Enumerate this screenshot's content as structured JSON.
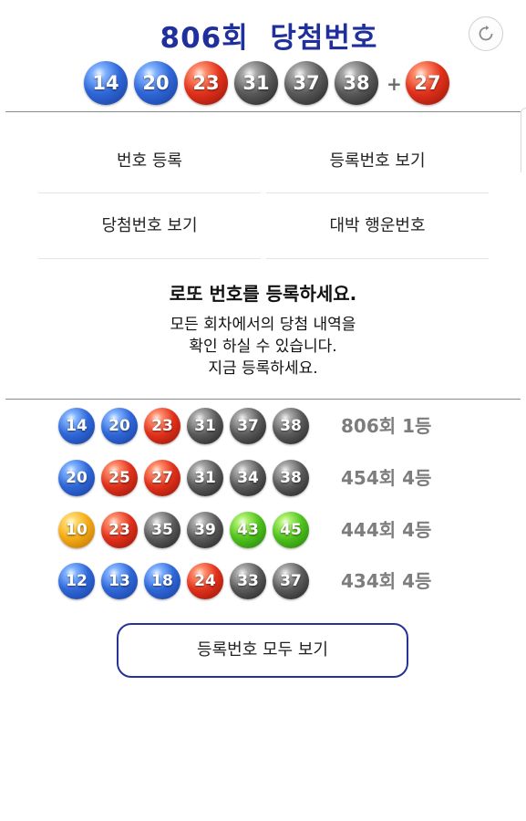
{
  "header": {
    "title": "806회  당첨번호",
    "balls": [
      {
        "number": "14",
        "color": "blue"
      },
      {
        "number": "20",
        "color": "blue"
      },
      {
        "number": "23",
        "color": "red"
      },
      {
        "number": "31",
        "color": "gray"
      },
      {
        "number": "37",
        "color": "gray"
      },
      {
        "number": "38",
        "color": "gray"
      }
    ],
    "plus": "+",
    "bonus": {
      "number": "27",
      "color": "red"
    },
    "refresh_icon": "refresh-icon"
  },
  "menu": {
    "register": "번호 등록",
    "view_registered": "등록번호 보기",
    "view_winning": "당첨번호 보기",
    "lucky_numbers": "대박 행운번호"
  },
  "notice": {
    "title": "로또 번호를 등록하세요.",
    "line1": "모든 회차에서의 당첨 내역을",
    "line2": "확인 하실 수 있습니다.",
    "line3": "지금 등록하세요."
  },
  "registered": [
    {
      "balls": [
        {
          "number": "14",
          "color": "blue"
        },
        {
          "number": "20",
          "color": "blue"
        },
        {
          "number": "23",
          "color": "red"
        },
        {
          "number": "31",
          "color": "gray"
        },
        {
          "number": "37",
          "color": "gray"
        },
        {
          "number": "38",
          "color": "gray"
        }
      ],
      "result": "806회 1등"
    },
    {
      "balls": [
        {
          "number": "20",
          "color": "blue"
        },
        {
          "number": "25",
          "color": "red"
        },
        {
          "number": "27",
          "color": "red"
        },
        {
          "number": "31",
          "color": "gray"
        },
        {
          "number": "34",
          "color": "gray"
        },
        {
          "number": "38",
          "color": "gray"
        }
      ],
      "result": "454회 4등"
    },
    {
      "balls": [
        {
          "number": "10",
          "color": "yellow"
        },
        {
          "number": "23",
          "color": "red"
        },
        {
          "number": "35",
          "color": "gray"
        },
        {
          "number": "39",
          "color": "gray"
        },
        {
          "number": "43",
          "color": "green"
        },
        {
          "number": "45",
          "color": "green"
        }
      ],
      "result": "444회 4등"
    },
    {
      "balls": [
        {
          "number": "12",
          "color": "blue"
        },
        {
          "number": "13",
          "color": "blue"
        },
        {
          "number": "18",
          "color": "blue"
        },
        {
          "number": "24",
          "color": "red"
        },
        {
          "number": "33",
          "color": "gray"
        },
        {
          "number": "37",
          "color": "gray"
        }
      ],
      "result": "434회 4등"
    }
  ],
  "view_all_label": "등록번호 모두 보기"
}
